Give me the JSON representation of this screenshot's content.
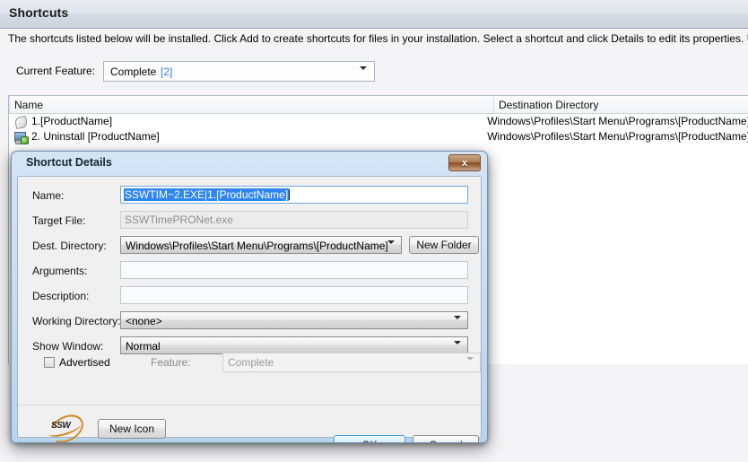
{
  "page": {
    "title": "Shortcuts",
    "description": "The shortcuts listed below will be installed. Click Add to create shortcuts for files in your installation. Select a shortcut and click Details to edit its properties. Use the Delete butto"
  },
  "feature": {
    "label": "Current Feature:",
    "value": "Complete",
    "count": "[2]",
    "arrow_icon": "chevron-down-icon"
  },
  "list": {
    "columns": [
      "Name",
      "Destination Directory"
    ],
    "rows": [
      {
        "icon": "shortcut-icon",
        "name": "1.[ProductName]",
        "destination": "Windows\\Profiles\\Start Menu\\Programs\\[ProductName]"
      },
      {
        "icon": "uninstall-icon",
        "name": "2. Uninstall [ProductName]",
        "destination": "Windows\\Profiles\\Start Menu\\Programs\\[ProductName]"
      }
    ]
  },
  "dialog": {
    "title": "Shortcut Details",
    "close_label": "x",
    "close_icon": "close-icon",
    "fields": {
      "name": {
        "label": "Name:",
        "value": "SSWTIM~2.EXE|1.[ProductName]",
        "selected": true
      },
      "target_file": {
        "label": "Target File:",
        "value": "SSWTimePRONet.exe",
        "readonly": true
      },
      "dest_directory": {
        "label": "Dest. Directory:",
        "value": "Windows\\Profiles\\Start Menu\\Programs\\[ProductName]",
        "new_folder_button": "New Folder"
      },
      "arguments": {
        "label": "Arguments:",
        "value": "",
        "placeholder": ""
      },
      "description": {
        "label": "Description:",
        "value": "",
        "placeholder": ""
      },
      "working_directory": {
        "label": "Working Directory:",
        "value": "<none>"
      },
      "show_window": {
        "label": "Show Window:",
        "value": "Normal"
      },
      "advertised": {
        "label": "Advertised",
        "checked": false
      },
      "feature": {
        "label": "Feature:",
        "value": "Complete",
        "disabled": true
      }
    },
    "logo": {
      "text": "SSW",
      "icon": "ssw-logo-icon"
    },
    "buttons": {
      "new_icon": "New Icon",
      "ok": "OK",
      "cancel": "Cancel"
    }
  },
  "colors": {
    "accent_blue": "#2f86f0",
    "link_blue": "#2d7fd6",
    "dialog_border": "#6d93b6",
    "close_button": "#8a4a1d",
    "logo_orange": "#d4861f"
  }
}
